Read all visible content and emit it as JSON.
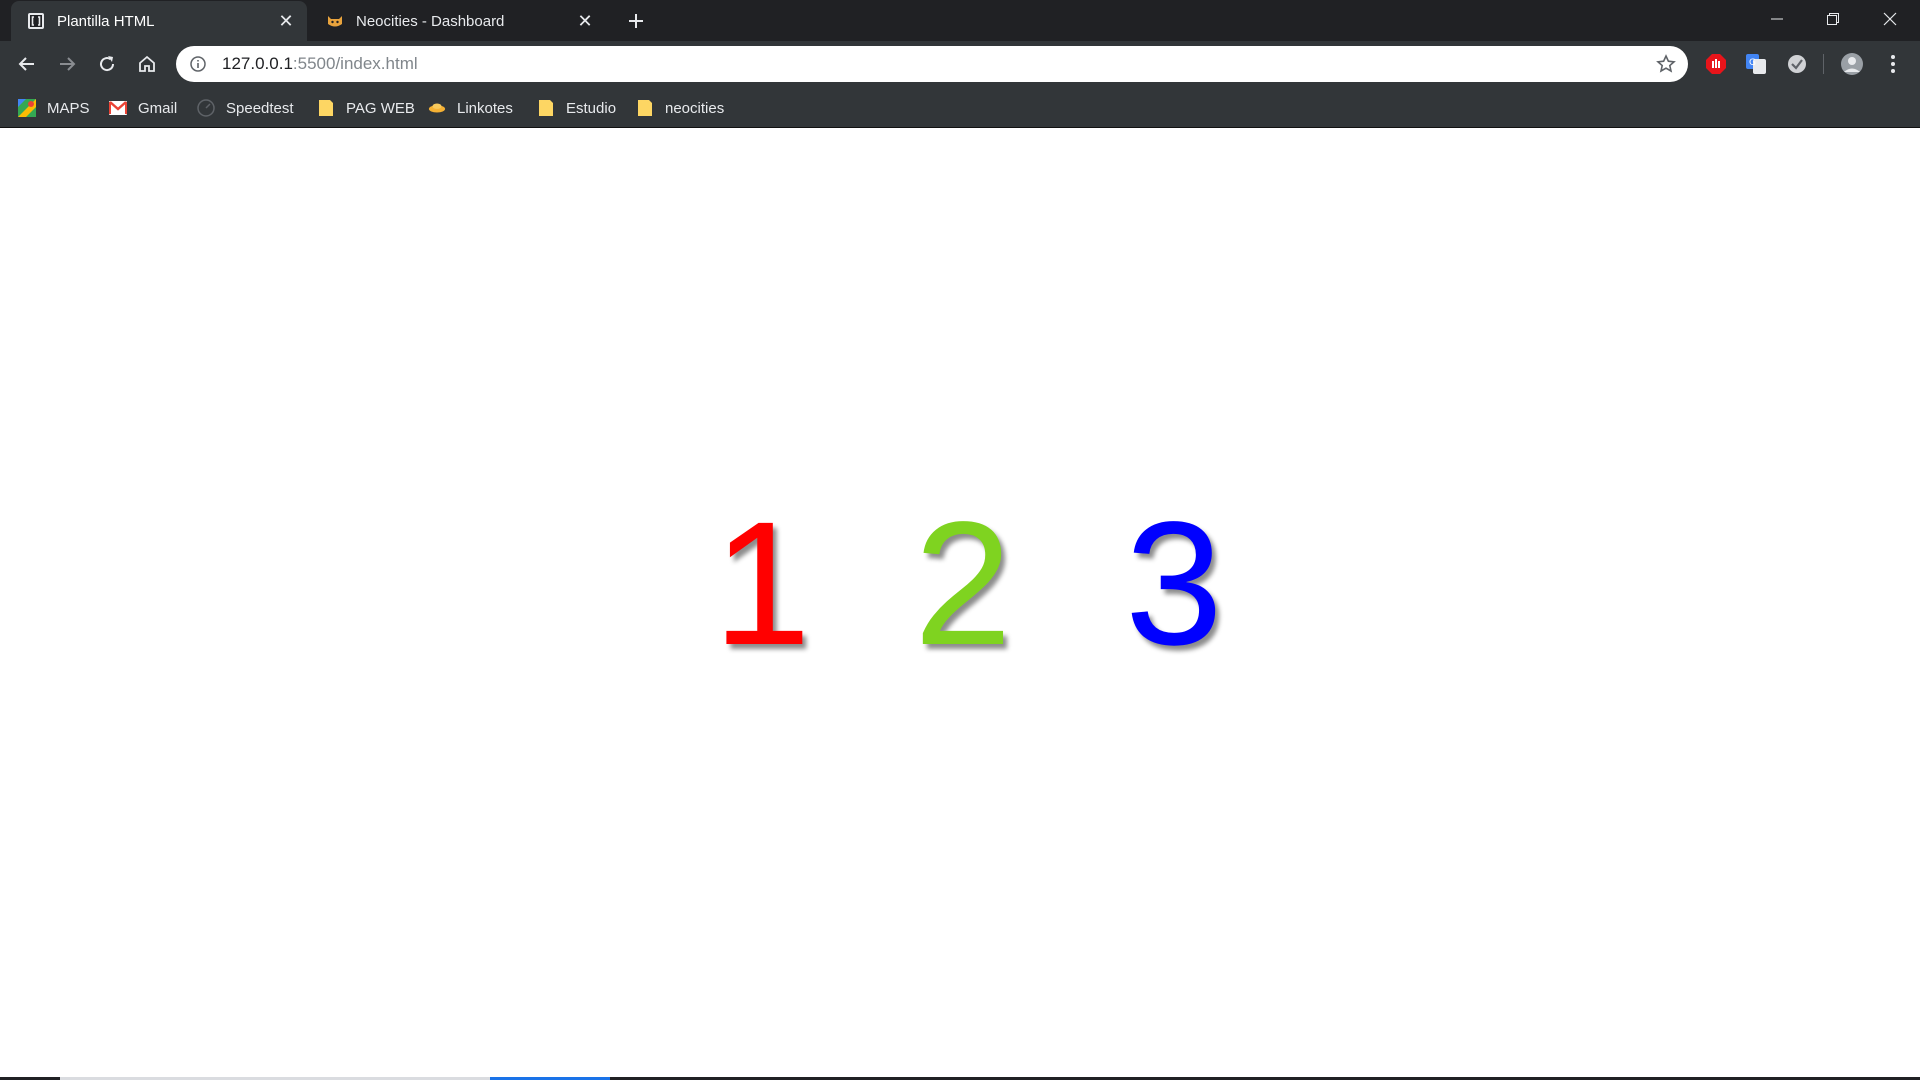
{
  "tabs": [
    {
      "title": "Plantilla HTML",
      "active": true,
      "favicon": "brackets-icon"
    },
    {
      "title": "Neocities - Dashboard",
      "active": false,
      "favicon": "neocities-cat-icon"
    }
  ],
  "new_tab_label": "+",
  "window_controls": [
    "minimize-icon",
    "restore-icon",
    "close-icon"
  ],
  "toolbar": {
    "url_host": "127.0.0.1",
    "url_rest": ":5500/index.html",
    "buttons": [
      "back-icon",
      "forward-icon",
      "reload-icon",
      "home-icon"
    ],
    "extensions": [
      "adblock-icon",
      "google-translate-icon",
      "extension-check-icon",
      "profile-avatar-icon",
      "menu-kebab-icon"
    ]
  },
  "bookmarks": [
    {
      "label": "MAPS",
      "icon": "google-maps-icon"
    },
    {
      "label": "Gmail",
      "icon": "gmail-icon"
    },
    {
      "label": "Speedtest",
      "icon": "speedtest-icon"
    },
    {
      "label": "PAG WEB",
      "icon": "folder-icon"
    },
    {
      "label": "Linkotes",
      "icon": "linkotes-icon"
    },
    {
      "label": "Estudio",
      "icon": "folder-icon"
    },
    {
      "label": "neocities",
      "icon": "folder-icon"
    }
  ],
  "page": {
    "numbers": [
      {
        "text": "1",
        "color": "#ff0000"
      },
      {
        "text": "2",
        "color": "#7fd320"
      },
      {
        "text": "3",
        "color": "#0000ff"
      }
    ]
  }
}
